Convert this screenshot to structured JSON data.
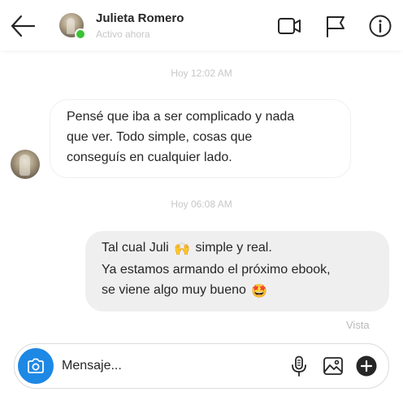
{
  "header": {
    "user_name": "Julieta Romero",
    "status": "Activo ahora",
    "online_color": "#3ac334",
    "icons": [
      "back-arrow-icon",
      "video-camera-icon",
      "flag-icon",
      "info-icon"
    ]
  },
  "conversation": {
    "timestamp_1": "Hoy 12:02 AM",
    "incoming": {
      "lines": [
        "Pensé que iba a ser complicado y nada",
        "que ver. Todo simple, cosas que",
        "conseguís en cualquier lado."
      ]
    },
    "timestamp_2": "Hoy 06:08 AM",
    "outgoing": {
      "line1_before": "Tal cual Juli",
      "line1_emoji": "🙌",
      "line1_after": "simple y real.",
      "line2": "Ya estamos armando el próximo ebook,",
      "line3": "se viene algo muy bueno",
      "line3_emoji": "🤩"
    },
    "seen_label": "Vista"
  },
  "composer": {
    "placeholder": "Mensaje...",
    "value": "",
    "camera_color": "#1e88e5",
    "icons": [
      "camera-icon",
      "microphone-icon",
      "image-icon",
      "plus-icon"
    ]
  }
}
